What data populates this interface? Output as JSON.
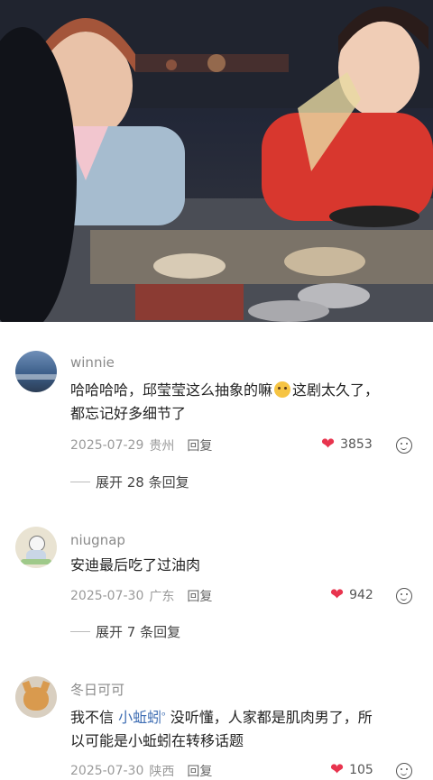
{
  "comments": [
    {
      "username": "winnie",
      "text_line1": "哈哈哈哈，邱莹莹这么抽象的嘛",
      "text_line1_tail": "这剧太久了，",
      "text_line2": "都忘记好多细节了",
      "date": "2025-07-29",
      "location": "贵州",
      "reply": "回复",
      "likes": "3853",
      "expand": "展开 28 条回复"
    },
    {
      "username": "niugnap",
      "text": "安迪最后吃了过油肉",
      "date": "2025-07-30",
      "location": "广东",
      "reply": "回复",
      "likes": "942",
      "expand": "展开 7 条回复"
    },
    {
      "username": "冬日可可",
      "text_prefix": "我不信 ",
      "mention": "小蚯蚓",
      "text_line1_tail": " 没听懂，人家都是肌肉男了，所",
      "text_line2": "以可能是小蚯蚓在转移话题",
      "date": "2025-07-30",
      "location": "陕西",
      "reply": "回复",
      "likes": "105"
    }
  ],
  "colors": {
    "heart": "#e8344e",
    "mention": "#3e6db3",
    "muted": "#9a9a9a"
  }
}
